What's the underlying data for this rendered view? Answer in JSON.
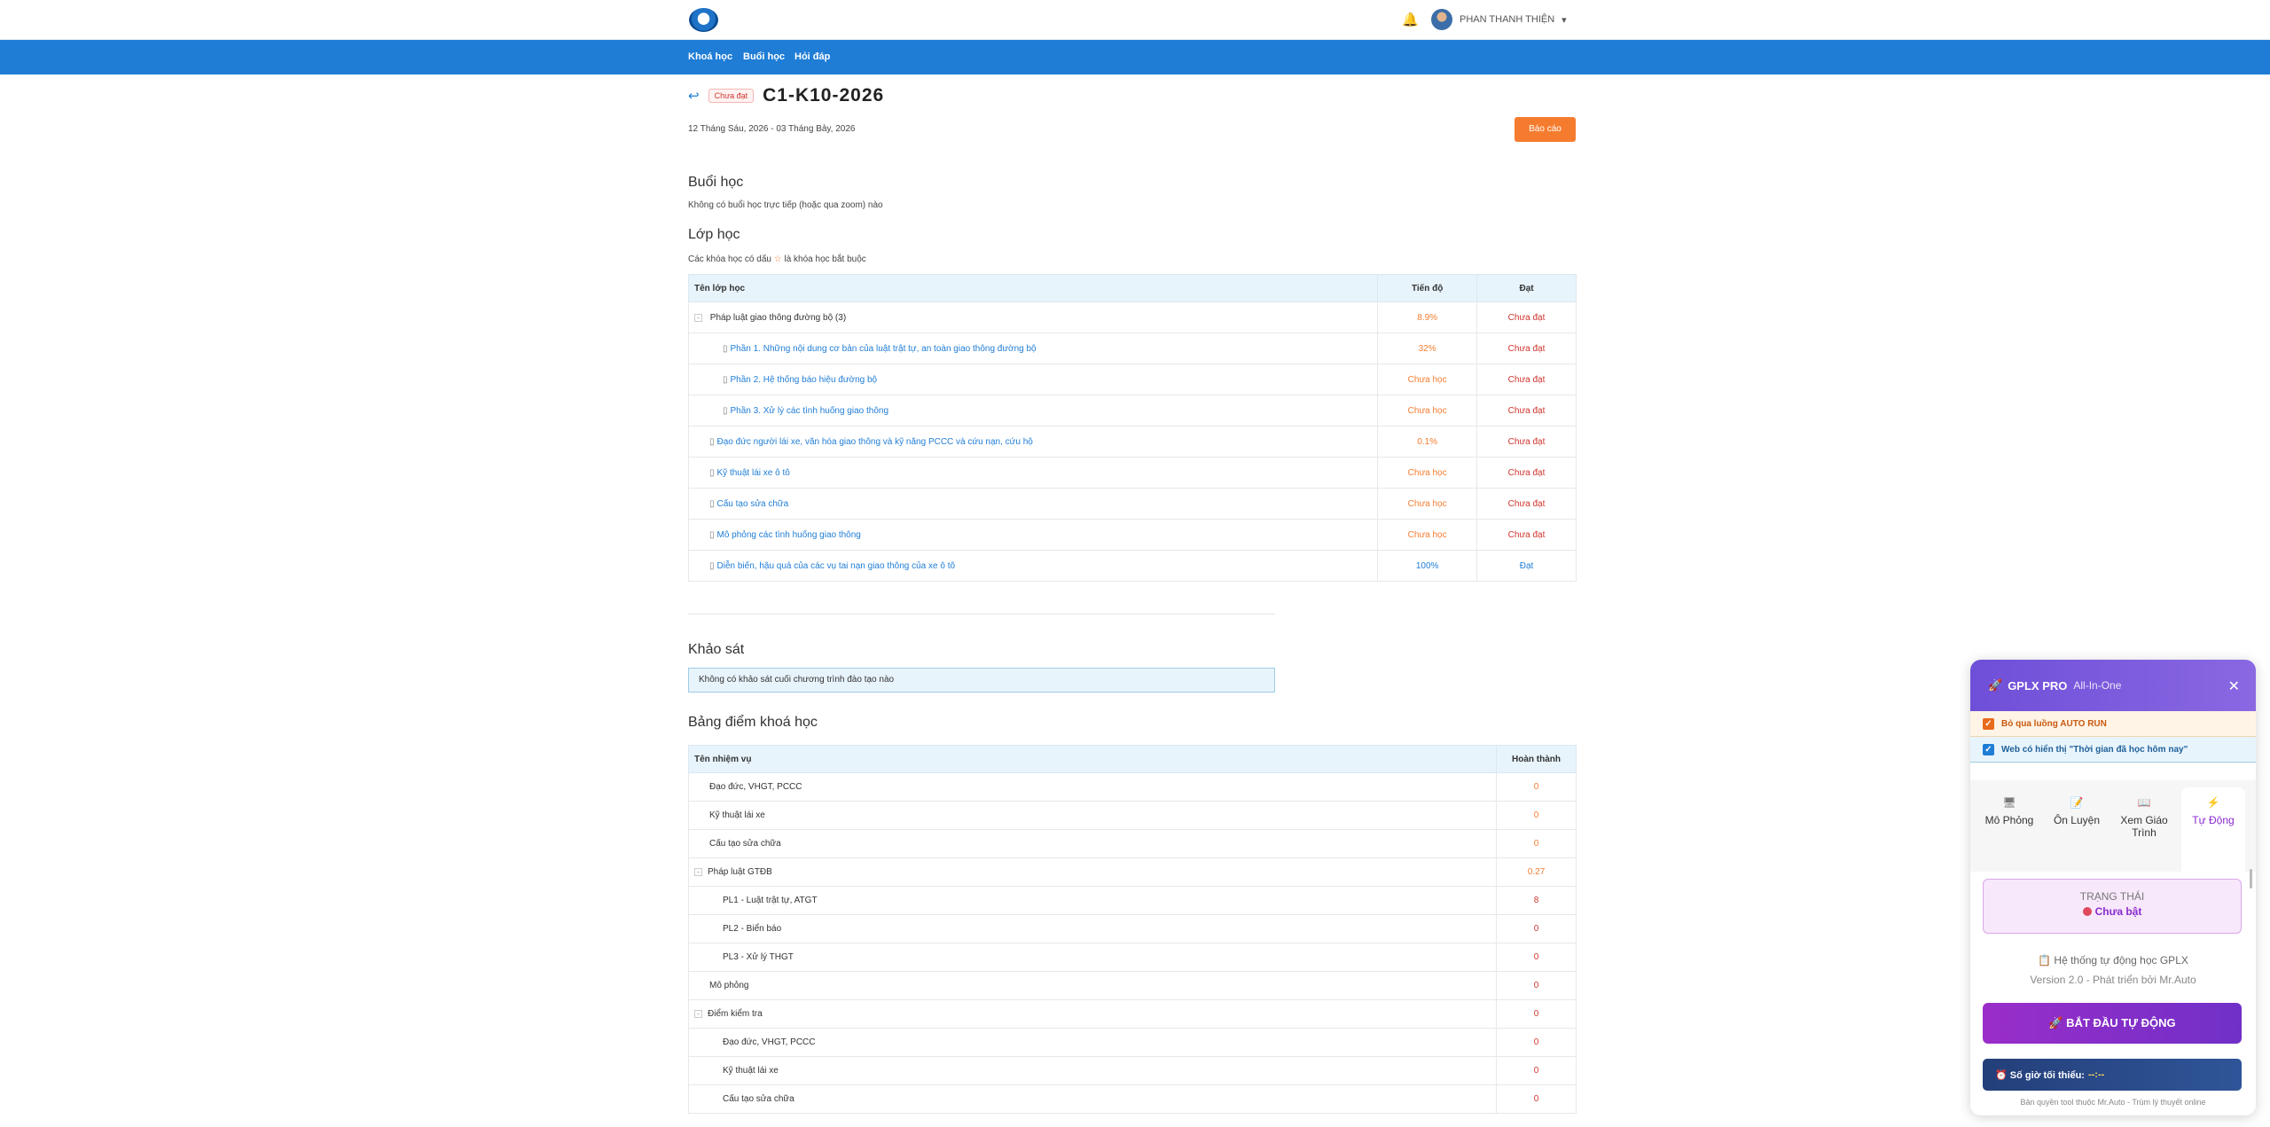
{
  "header": {
    "user_name": "PHAN THANH THIỆN",
    "caret": "▾",
    "bell": "🔔"
  },
  "nav": {
    "items": [
      "Khoá học",
      "Buổi học",
      "Hỏi đáp"
    ]
  },
  "course": {
    "back_icon": "↩",
    "status_badge": "Chưa đạt",
    "title": "C1-K10-2026",
    "dates": "12 Tháng Sáu, 2026 - 03 Tháng Bảy, 2026",
    "report_button": "Báo cáo"
  },
  "sessions": {
    "heading": "Buổi học",
    "note": "Không có buổi học trực tiếp (hoặc qua zoom) nào"
  },
  "classes": {
    "heading": "Lớp học",
    "note_before": "Các khóa học có dấu",
    "note_star": "☆",
    "note_after": "là khóa học bắt buộc",
    "col_name": "Tên lớp học",
    "col_progress": "Tiến độ",
    "col_pass": "Đạt",
    "group": {
      "toggle": "-",
      "name": "Pháp luật giao thông đường bộ",
      "count": "(3)",
      "progress": "8.9%",
      "pass": "Chưa đạt"
    },
    "rows": [
      {
        "name": "Phần 1. Những nội dung cơ bản của luật trật tự, an toàn giao thông đường bộ",
        "progress": "32%",
        "pass": "Chưa đạt"
      },
      {
        "name": "Phần 2. Hệ thống báo hiệu đường bộ",
        "progress": "Chưa học",
        "pass": "Chưa đạt"
      },
      {
        "name": "Phần 3. Xử lý các tình huống giao thông",
        "progress": "Chưa học",
        "pass": "Chưa đạt"
      },
      {
        "name": "Đạo đức người lái xe, văn hóa giao thông và kỹ năng PCCC và cứu nạn, cứu hộ",
        "progress": "0.1%",
        "pass": "Chưa đạt"
      },
      {
        "name": "Kỹ thuật lái xe ô tô",
        "progress": "Chưa học",
        "pass": "Chưa đạt"
      },
      {
        "name": "Cấu tạo sửa chữa",
        "progress": "Chưa học",
        "pass": "Chưa đạt"
      },
      {
        "name": "Mô phỏng các tình huống giao thông",
        "progress": "Chưa học",
        "pass": "Chưa đạt"
      },
      {
        "name": "Diễn biến, hậu quả của các vụ tai nạn giao thông của xe ô tô",
        "progress": "100%",
        "pass": "Đạt"
      }
    ]
  },
  "survey": {
    "heading": "Khảo sát",
    "note": "Không có khảo sát cuối chương trình đào tạo nào"
  },
  "scores": {
    "heading": "Bảng điểm khoá học",
    "col_task": "Tên nhiệm vụ",
    "col_done": "Hoàn thành",
    "rows": [
      {
        "name": "Đạo đức, VHGT, PCCC",
        "value": "0",
        "toggle": ""
      },
      {
        "name": "Kỹ thuật lái xe",
        "value": "0",
        "toggle": ""
      },
      {
        "name": "Cấu tạo sửa chữa",
        "value": "0",
        "toggle": ""
      },
      {
        "name": "Pháp luật GTĐB",
        "value": "0.27",
        "toggle": "-"
      },
      {
        "name": "PL1 - Luật trật tự, ATGT",
        "value": "8",
        "toggle": ""
      },
      {
        "name": "PL2 - Biển báo",
        "value": "0",
        "toggle": ""
      },
      {
        "name": "PL3 - Xử lý THGT",
        "value": "0",
        "toggle": ""
      },
      {
        "name": "Mô phỏng",
        "value": "0",
        "toggle": ""
      },
      {
        "name": "Điểm kiểm tra",
        "value": "0",
        "toggle": "-"
      },
      {
        "name": "Đạo đức, VHGT, PCCC",
        "value": "0",
        "toggle": ""
      },
      {
        "name": "Kỹ thuật lái xe",
        "value": "0",
        "toggle": ""
      },
      {
        "name": "Cấu tạo sửa chữa",
        "value": "0",
        "toggle": ""
      }
    ]
  },
  "panel": {
    "rocket": "🚀",
    "brand": "GPLX PRO",
    "subtitle": "All-In-One",
    "close": "✕",
    "option1": "Bỏ qua luồng AUTO RUN",
    "option2": "Web có hiển thị \"Thời gian đã học hôm nay\"",
    "tabs": [
      {
        "icon": "🖥",
        "label": "Mô Phỏng"
      },
      {
        "icon": "📝",
        "label": "Ôn Luyện"
      },
      {
        "icon": "📖",
        "label": "Xem Giáo Trình"
      },
      {
        "icon": "⚡",
        "label": "Tự Động"
      }
    ],
    "status_label": "TRẠNG THÁI",
    "status_value": "Chưa bật",
    "system_line": "📋 Hệ thống tự động học GPLX",
    "version_line": "Version 2.0 - Phát triển bởi Mr.Auto",
    "start_button": "🚀 BẮT ĐẦU TỰ ĐỘNG",
    "min_hours_label": "⏰ Số giờ tối thiểu:",
    "min_hours_value": "--:--",
    "copyright": "Bản quyền tool thuộc Mr.Auto - Trùm lý thuyết online"
  }
}
